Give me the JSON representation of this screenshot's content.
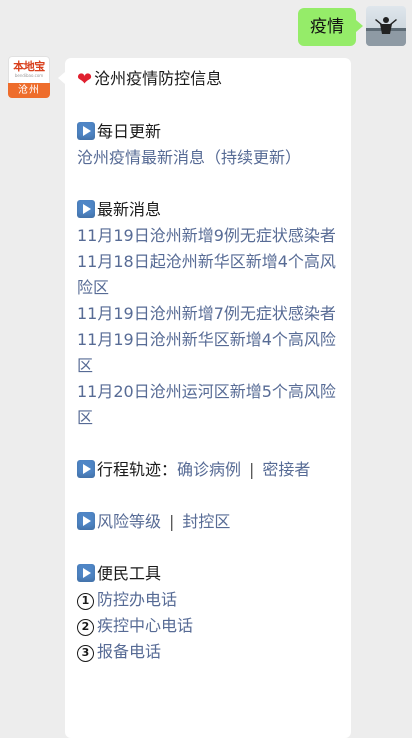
{
  "outgoing": {
    "text": "疫情"
  },
  "sender": {
    "logo_text": "本地宝",
    "logo_url": "bendibao.com",
    "logo_city": "沧州"
  },
  "message": {
    "title": "沧州疫情防控信息",
    "daily": {
      "heading": "每日更新",
      "link": "沧州疫情最新消息（持续更新）"
    },
    "news": {
      "heading": "最新消息",
      "items": [
        "11月19日沧州新增9例无症状感染者",
        "11月18日起沧州新华区新增4个高风险区",
        "11月19日沧州新增7例无症状感染者",
        "11月19日沧州新华区新增4个高风险区",
        "11月20日沧州运河区新增5个高风险区"
      ]
    },
    "trace": {
      "heading": "行程轨迹：",
      "link1": "确诊病例",
      "separator": "|",
      "link2": "密接者"
    },
    "risk": {
      "link1": "风险等级",
      "separator": "|",
      "link2": "封控区"
    },
    "tools": {
      "heading": "便民工具",
      "items": [
        {
          "num": "1",
          "label": "防控办电话"
        },
        {
          "num": "2",
          "label": "疾控中心电话"
        },
        {
          "num": "3",
          "label": "报备电话"
        }
      ]
    }
  },
  "icons": {
    "title_icon": "heart-icon",
    "section_icon": "play-button-icon"
  },
  "colors": {
    "outgoing_bubble": "#95ec69",
    "link": "#576b95",
    "heart": "#e0202f",
    "play_icon": "#4f86c6",
    "background": "#ededed"
  }
}
